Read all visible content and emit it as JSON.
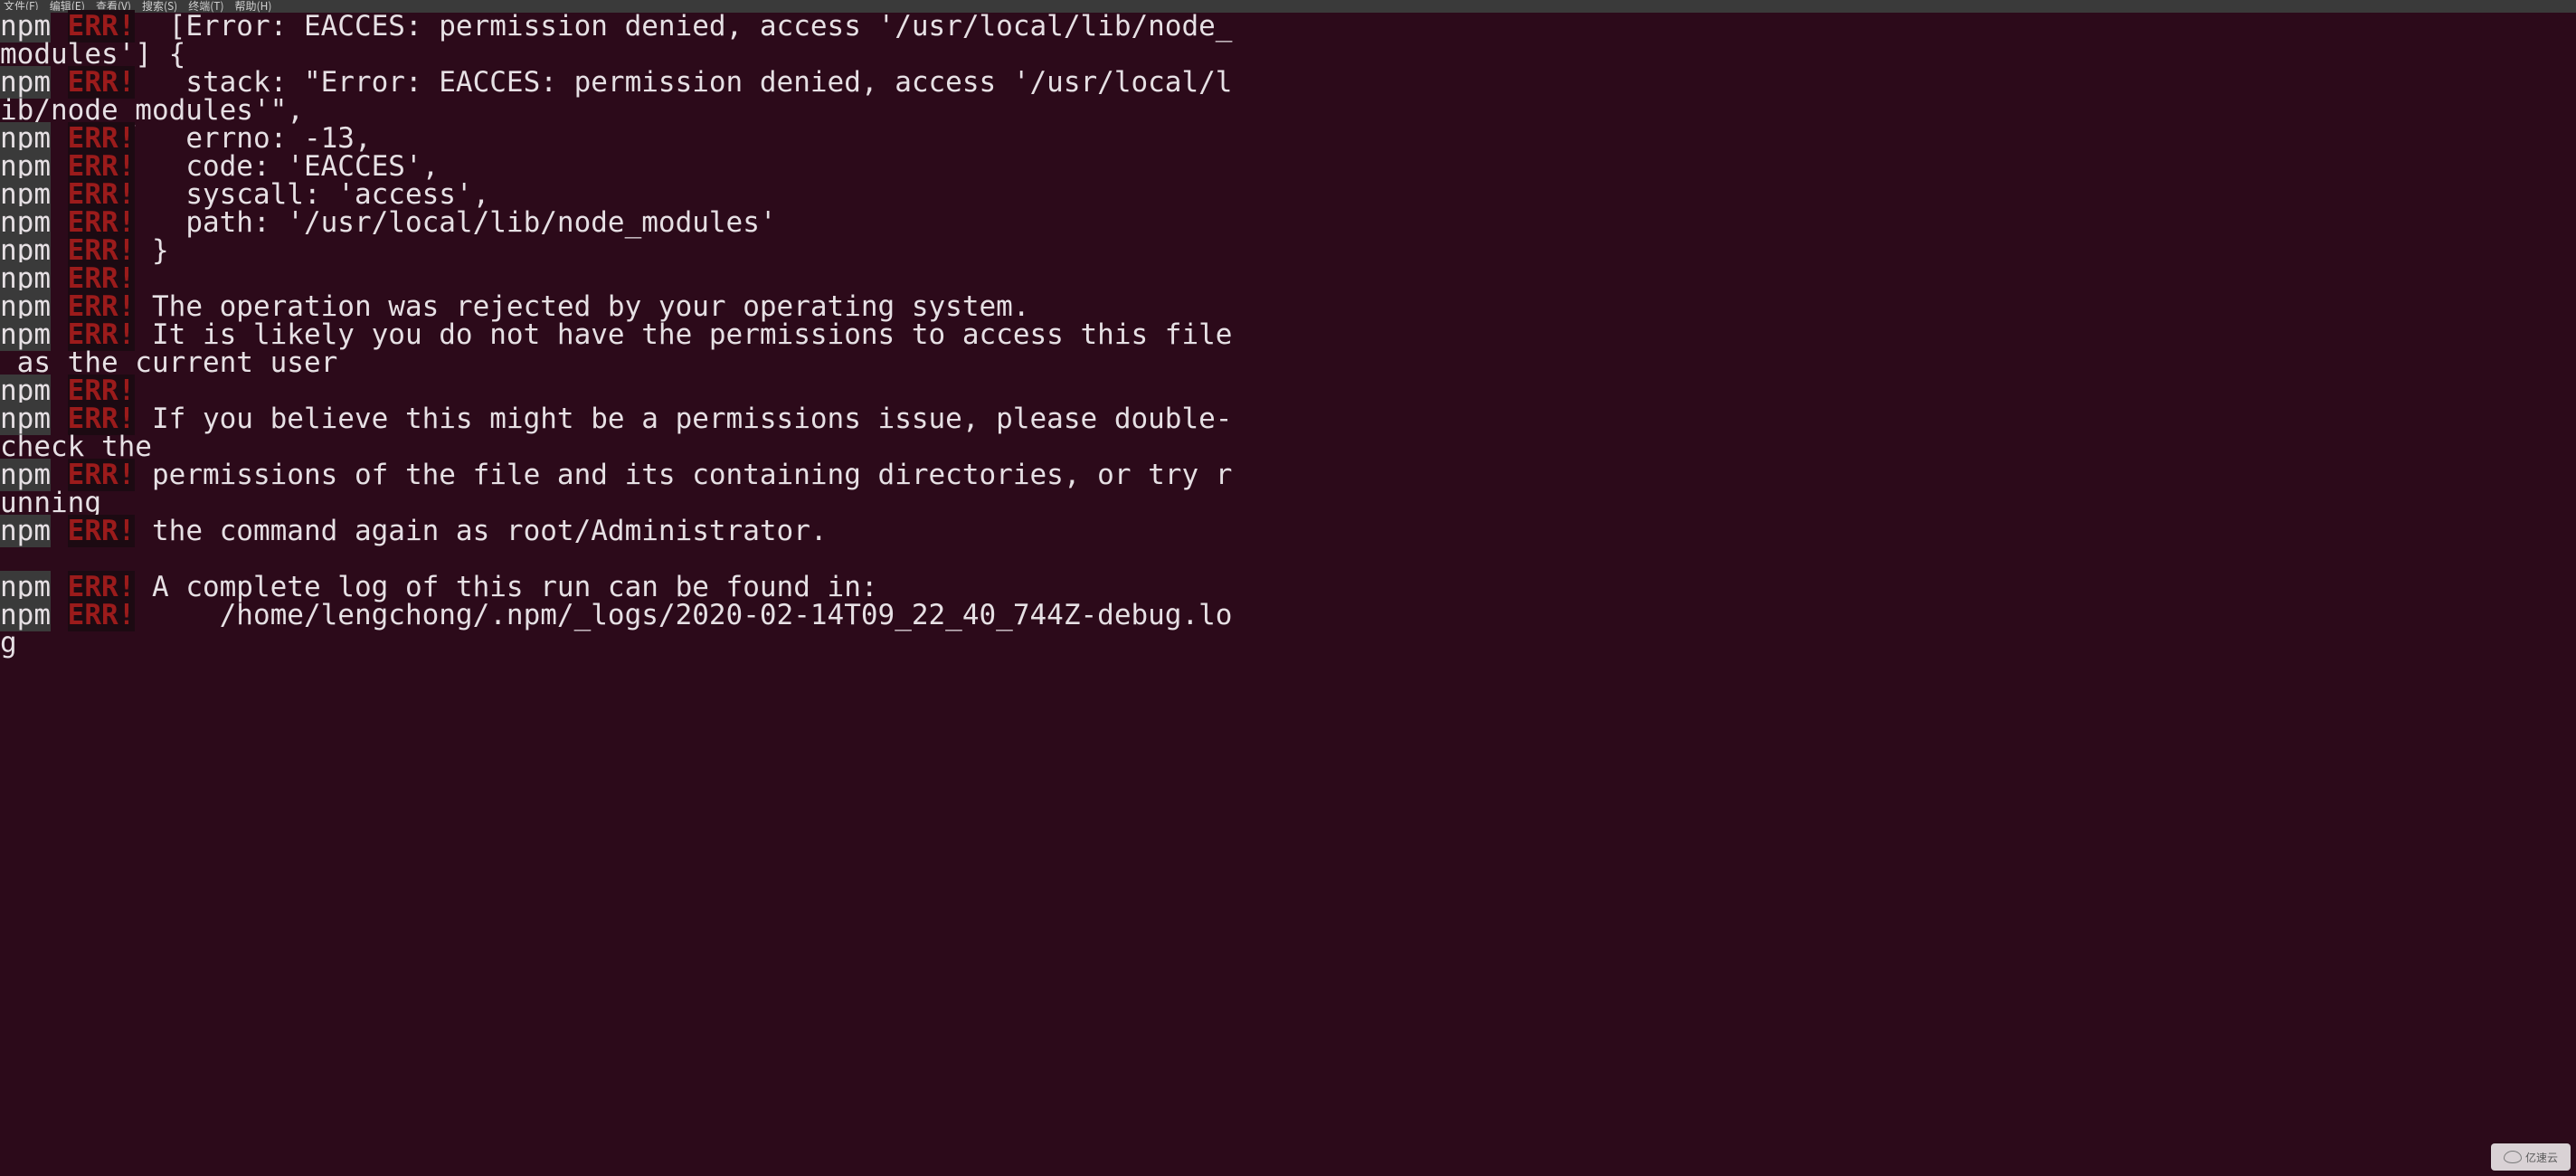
{
  "menubar": {
    "items": [
      "文件(F)",
      "编辑(E)",
      "查看(V)",
      "搜索(S)",
      "终端(T)",
      "帮助(H)"
    ]
  },
  "prefix": {
    "npm": "npm",
    "err": "ERR!"
  },
  "lines": [
    {
      "t": "err",
      "text": "  [Error: EACCES: permission denied, access '/usr/local/lib/node_"
    },
    {
      "t": "cont",
      "text": "modules'] {"
    },
    {
      "t": "err",
      "text": "   stack: \"Error: EACCES: permission denied, access '/usr/local/l"
    },
    {
      "t": "cont",
      "text": "ib/node_modules'\","
    },
    {
      "t": "err",
      "text": "   errno: -13,"
    },
    {
      "t": "err",
      "text": "   code: 'EACCES',"
    },
    {
      "t": "err",
      "text": "   syscall: 'access',"
    },
    {
      "t": "err",
      "text": "   path: '/usr/local/lib/node_modules'"
    },
    {
      "t": "err",
      "text": " }"
    },
    {
      "t": "err",
      "text": " "
    },
    {
      "t": "err",
      "text": " The operation was rejected by your operating system."
    },
    {
      "t": "err",
      "text": " It is likely you do not have the permissions to access this file"
    },
    {
      "t": "cont",
      "text": " as the current user"
    },
    {
      "t": "err",
      "text": " "
    },
    {
      "t": "err",
      "text": " If you believe this might be a permissions issue, please double-"
    },
    {
      "t": "cont",
      "text": "check the"
    },
    {
      "t": "err",
      "text": " permissions of the file and its containing directories, or try r"
    },
    {
      "t": "cont",
      "text": "unning"
    },
    {
      "t": "err",
      "text": " the command again as root/Administrator."
    },
    {
      "t": "blank"
    },
    {
      "t": "err",
      "text": " A complete log of this run can be found in:"
    },
    {
      "t": "err",
      "text": "     /home/lengchong/.npm/_logs/2020-02-14T09_22_40_744Z-debug.lo"
    },
    {
      "t": "cont",
      "text": "g"
    }
  ],
  "watermark": "亿速云"
}
